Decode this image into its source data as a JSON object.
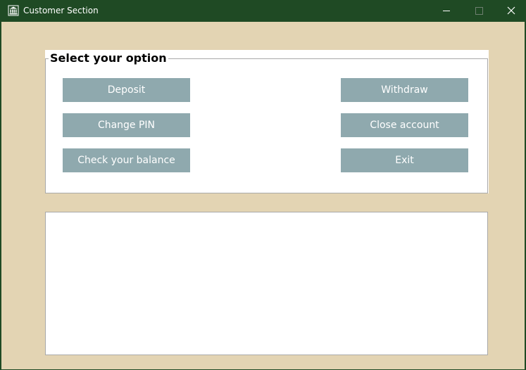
{
  "window": {
    "title": "Customer Section",
    "icon": "bank-icon",
    "controls": {
      "minimize_icon": "minimize-icon",
      "maximize_icon": "maximize-icon",
      "close_icon": "close-icon"
    }
  },
  "options_group": {
    "label": "Select your option",
    "buttons": {
      "deposit": "Deposit",
      "change_pin": "Change PIN",
      "check_balance": "Check your balance",
      "withdraw": "Withdraw",
      "close_account": "Close account",
      "exit": "Exit"
    }
  },
  "output_area": {
    "text": ""
  },
  "colors": {
    "titlebar": "#1f4a24",
    "window_background": "#e3d4b3",
    "button_background": "#8fa9ae",
    "button_text": "#ffffff",
    "panel_background": "#ffffff"
  }
}
